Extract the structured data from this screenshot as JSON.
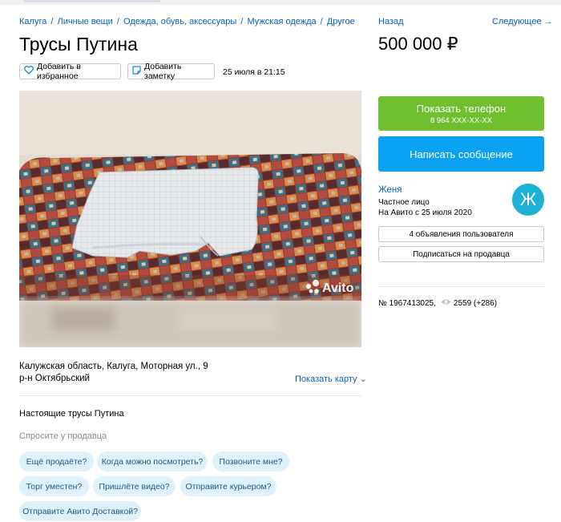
{
  "breadcrumb": [
    "Калуга",
    "Личные вещи",
    "Одежда, обувь, аксессуары",
    "Мужская одежда",
    "Другое"
  ],
  "breadcrumb_separator": "/",
  "title": "Трусы Путина",
  "actions": {
    "favorite_label": "Добавить в избранное",
    "note_label": "Добавить заметку"
  },
  "posted_date": "25 июля в 21:15",
  "photo": {
    "watermark": "Avito"
  },
  "location": {
    "address": "Калужская область, Калуга, Моторная ул., 9",
    "district": "р-н Октябрьский",
    "show_map_label": "Показать карту ⌄"
  },
  "description": "Настоящие трусы Путина",
  "ask_seller": {
    "heading": "Спросите у продавца",
    "chips": [
      "Ещё продаёте?",
      "Когда можно посмотреть?",
      "Позвоните мне?",
      "Торг уместен?",
      "Пришлёте видео?",
      "Отправите курьером?",
      "Отправите Авито Доставкой?"
    ]
  },
  "nav": {
    "back_label": "Назад",
    "next_label": "Следующее →"
  },
  "price": "500 000 ₽",
  "contact": {
    "show_phone_label": "Показать телефон",
    "phone_masked": "8 964 XXX-XX-XX",
    "write_message_label": "Написать сообщение"
  },
  "seller": {
    "name": "Женя",
    "type": "Частное лицо",
    "since": "На Авито с 25 июля 2020",
    "avatar_letter": "Ж",
    "ads_button": "4 объявления пользователя",
    "subscribe_button": "Подписаться на продавца"
  },
  "listing_stats": {
    "id_text": "№ 1967413025,",
    "views_text": "2559 (+286)"
  },
  "colors": {
    "link": "#0a60b6",
    "green_button": "#6fbf2f",
    "blue_button": "#0aa1f2",
    "chip_bg": "#dff1fb",
    "avatar_bg": "#1cb0d4"
  },
  "icons": [
    "heart-icon",
    "note-icon",
    "eye-icon",
    "chevron-down-icon",
    "arrow-right-icon"
  ]
}
